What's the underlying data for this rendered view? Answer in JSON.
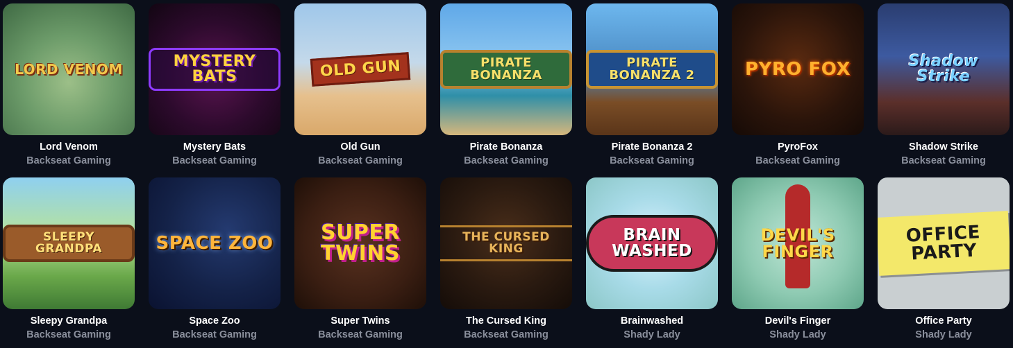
{
  "games": [
    {
      "title": "Lord Venom",
      "provider": "Backseat Gaming",
      "logo_text": "LORD VENOM"
    },
    {
      "title": "Mystery Bats",
      "provider": "Backseat Gaming",
      "logo_text": "MYSTERY BATS"
    },
    {
      "title": "Old Gun",
      "provider": "Backseat Gaming",
      "logo_text": "OLD GUN"
    },
    {
      "title": "Pirate Bonanza",
      "provider": "Backseat Gaming",
      "logo_text": "PIRATE BONANZA"
    },
    {
      "title": "Pirate Bonanza 2",
      "provider": "Backseat Gaming",
      "logo_text": "PIRATE BONANZA 2"
    },
    {
      "title": "PyroFox",
      "provider": "Backseat Gaming",
      "logo_text": "PYRO FOX"
    },
    {
      "title": "Shadow Strike",
      "provider": "Backseat Gaming",
      "logo_text": "Shadow Strike"
    },
    {
      "title": "Sleepy Grandpa",
      "provider": "Backseat Gaming",
      "logo_text": "SLEEPY GRANDPA"
    },
    {
      "title": "Space Zoo",
      "provider": "Backseat Gaming",
      "logo_text": "SPACE ZOO"
    },
    {
      "title": "Super Twins",
      "provider": "Backseat Gaming",
      "logo_text": "SUPER TWINS"
    },
    {
      "title": "The Cursed King",
      "provider": "Backseat Gaming",
      "logo_text": "THE CURSED KING"
    },
    {
      "title": "Brainwashed",
      "provider": "Shady Lady",
      "logo_text": "BRAIN WASHED"
    },
    {
      "title": "Devil's Finger",
      "provider": "Shady Lady",
      "logo_text": "DEVIL'S FINGER"
    },
    {
      "title": "Office Party",
      "provider": "Shady Lady",
      "logo_text": "OFFICE PARTY"
    }
  ]
}
